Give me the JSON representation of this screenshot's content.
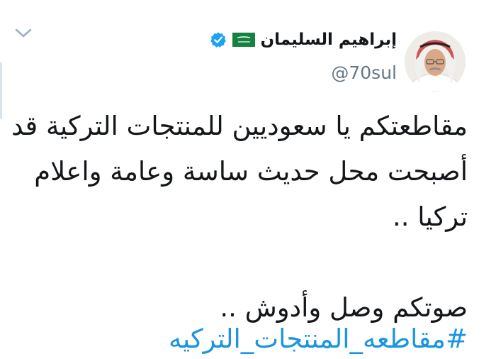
{
  "tweet": {
    "author": {
      "display_name": "إبراهيم السليمان",
      "handle": "@70sul",
      "flag_text": "لا إله إلا الله",
      "flag_icon": "saudi-flag-icon",
      "verified_icon": "verified-badge-icon",
      "avatar": "author-avatar"
    },
    "menu_icon": "chevron-down-icon",
    "text_lines": [
      "مقاطعتكم يا سعوديين للمنتجات التركية قد",
      "أصبحت محل حديث ساسة وعامة واعلام",
      "تركيا ..",
      "صوتكم وصل وأدوش  .."
    ],
    "hashtag": "#مقاطعه_المنتجات_التركيه"
  },
  "colors": {
    "text": "#14171a",
    "secondary": "#657786",
    "link": "#1b95e0",
    "verified": "#1da1f2",
    "flag_green": "#16823f"
  }
}
